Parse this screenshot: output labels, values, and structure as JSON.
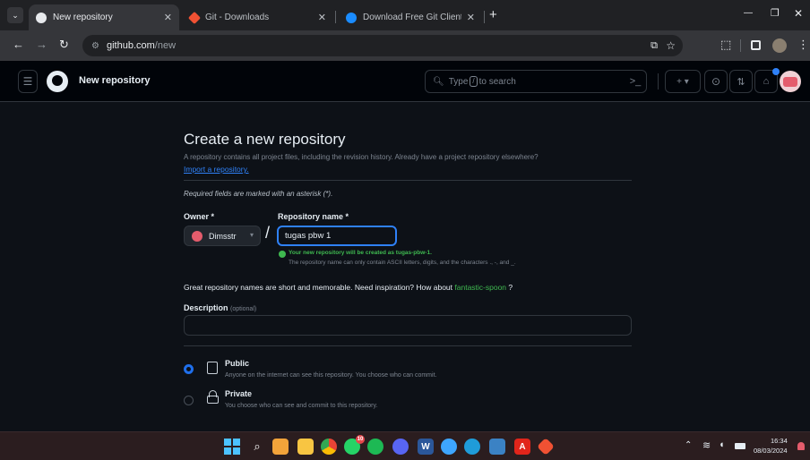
{
  "browser": {
    "tabs": [
      {
        "label": "New repository",
        "active": true
      },
      {
        "label": "Git - Downloads",
        "active": false
      },
      {
        "label": "Download Free Git Client - Win",
        "active": false
      }
    ],
    "new_tab_glyph": "+",
    "url_host": "github.com",
    "url_path": "/new",
    "window_controls": {
      "minimize": "—",
      "restore": "❐",
      "close": "✕"
    }
  },
  "header": {
    "title": "New repository",
    "search_label": "Type",
    "search_key": "/",
    "search_suffix": "to search",
    "create_glyph": "+ ▾"
  },
  "main": {
    "heading": "Create a new repository",
    "description": "A repository contains all project files, including the revision history. Already have a project repository elsewhere?",
    "import_link": "Import a repository.",
    "required_note": "Required fields are marked with an asterisk (*).",
    "owner_label": "Owner *",
    "owner_value": "Dimsstr",
    "separator": "/",
    "repo_name_label": "Repository name *",
    "repo_name_value": "tugas pbw 1",
    "availability_message": "Your new repository will be created as tugas-pbw-1.",
    "name_rules": "The repository name can only contain ASCII letters, digits, and the characters ., -, and _.",
    "inspiration_text": "Great repository names are short and memorable. Need inspiration? How about",
    "suggestion": "fantastic-spoon",
    "suggestion_suffix": "?",
    "description_label": "Description",
    "description_optional": "(optional)",
    "description_value": "",
    "visibility": [
      {
        "label": "Public",
        "hint": "Anyone on the internet can see this repository. You choose who can commit.",
        "selected": true
      },
      {
        "label": "Private",
        "hint": "You choose who can see and commit to this repository.",
        "selected": false
      }
    ]
  },
  "taskbar": {
    "whatsapp_badge": "10",
    "clock_time": "16:34",
    "clock_date": "08/03/2024"
  },
  "colors": {
    "accent_blue": "#2f81f7",
    "success_green": "#3fb950",
    "radio_blue": "#1f6feb"
  }
}
